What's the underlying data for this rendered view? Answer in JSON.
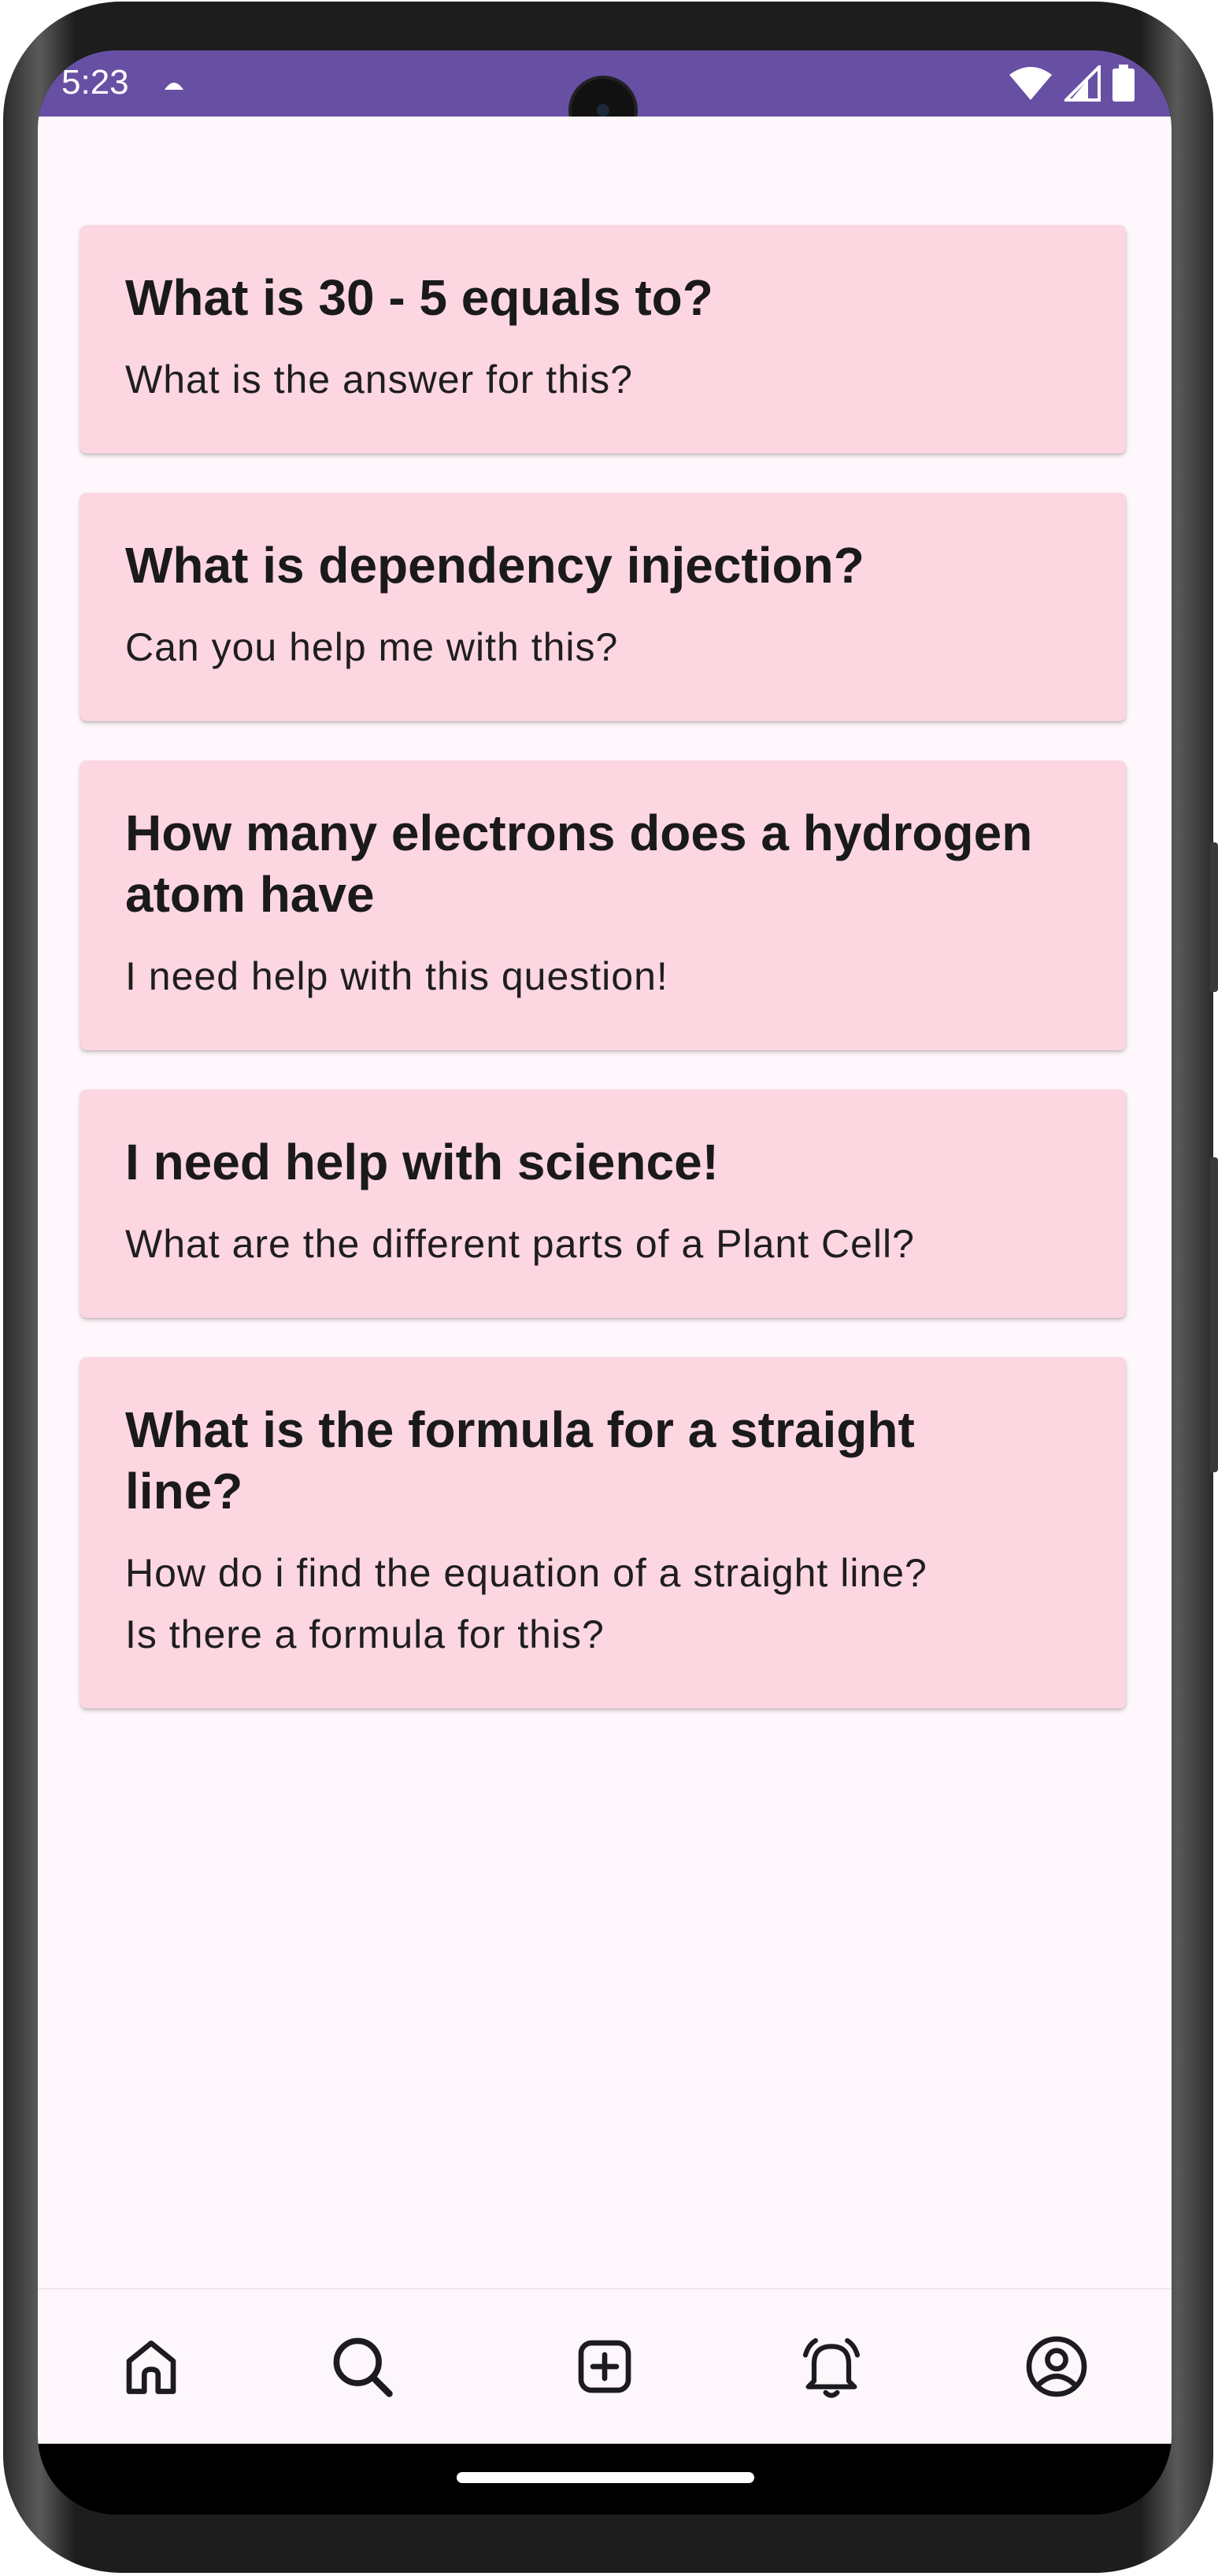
{
  "status_bar": {
    "time": "5:23",
    "icons": [
      "notification-icon",
      "wifi-icon",
      "signal-icon",
      "battery-icon"
    ],
    "color": "#6750a4"
  },
  "questions": [
    {
      "title": "What is 30 - 5 equals to?",
      "body": "What is the answer for this?"
    },
    {
      "title": "What is dependency injection?",
      "body": "Can you help me with this?"
    },
    {
      "title_lines": [
        "How many electrons does a hydrogen",
        "atom have"
      ],
      "body": "I need help with this question!"
    },
    {
      "title": "I need help with science!",
      "body": "What are the different parts of a Plant Cell?"
    },
    {
      "title_lines": [
        "What is the formula for a straight",
        "line?"
      ],
      "body_lines": [
        "How do i find the equation of a straight line?",
        "Is there a formula for this?"
      ]
    }
  ],
  "bottom_nav": {
    "items": [
      "home-icon",
      "search-icon",
      "add-icon",
      "notifications-icon",
      "profile-icon"
    ]
  },
  "colors": {
    "card_background": "#fcd6e0",
    "page_background": "#fef7fb"
  }
}
